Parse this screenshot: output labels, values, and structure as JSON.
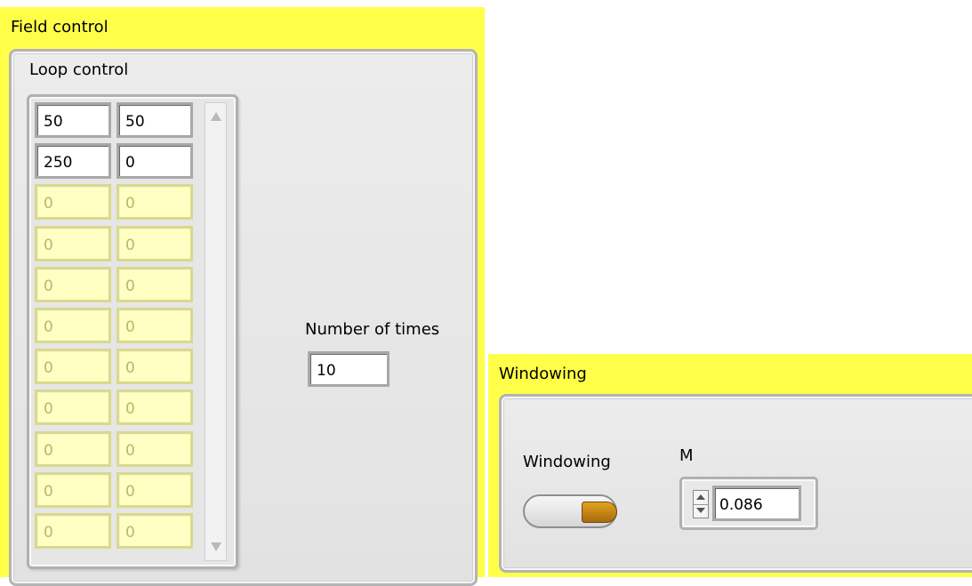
{
  "field_control": {
    "title": "Field control",
    "loop_control": {
      "label": "Loop control",
      "rows": [
        {
          "c1": "50",
          "c2": "50",
          "active": true
        },
        {
          "c1": "250",
          "c2": "0",
          "active": true
        },
        {
          "c1": "0",
          "c2": "0",
          "active": false
        },
        {
          "c1": "0",
          "c2": "0",
          "active": false
        },
        {
          "c1": "0",
          "c2": "0",
          "active": false
        },
        {
          "c1": "0",
          "c2": "0",
          "active": false
        },
        {
          "c1": "0",
          "c2": "0",
          "active": false
        },
        {
          "c1": "0",
          "c2": "0",
          "active": false
        },
        {
          "c1": "0",
          "c2": "0",
          "active": false
        },
        {
          "c1": "0",
          "c2": "0",
          "active": false
        },
        {
          "c1": "0",
          "c2": "0",
          "active": false
        }
      ]
    },
    "number_of_times": {
      "label": "Number of times",
      "value": "10"
    }
  },
  "windowing": {
    "title": "Windowing",
    "toggle": {
      "label": "Windowing",
      "state": "on"
    },
    "m": {
      "label": "M",
      "value": "0.086"
    }
  },
  "colors": {
    "pane_background": "#ffff4a",
    "frame_background": "#e6e6e6",
    "inactive_cell": "#ffffc4",
    "toggle_knob": "#c8861a"
  },
  "icons": {
    "scroll_up": "triangle-up-icon",
    "scroll_down": "triangle-down-icon",
    "step_up": "increment-icon",
    "step_down": "decrement-icon"
  }
}
